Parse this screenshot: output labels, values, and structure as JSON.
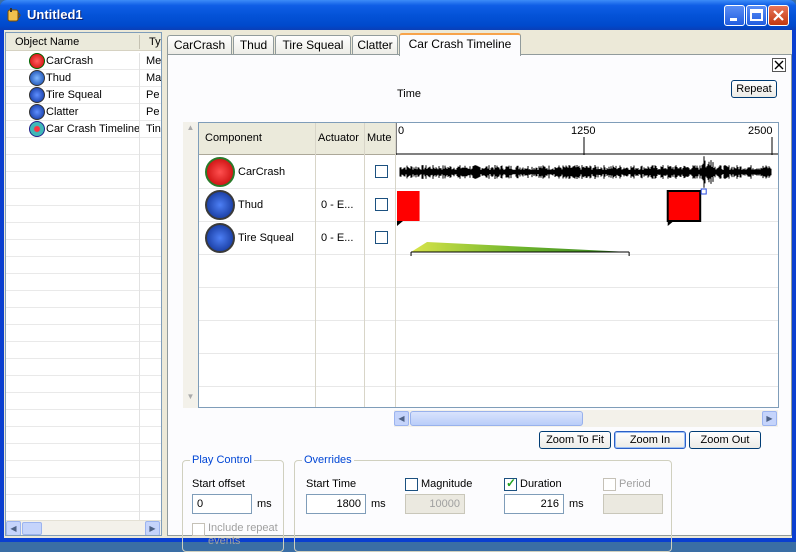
{
  "window": {
    "title": "Untitled1",
    "app_icon": "cup-icon"
  },
  "left_panel": {
    "columns": [
      "Object Name",
      "Ty"
    ],
    "rows": [
      {
        "name": "CarCrash",
        "type": "Me",
        "icon": "compound-effect-icon"
      },
      {
        "name": "Thud",
        "type": "Ma",
        "icon": "magnitude-effect-icon"
      },
      {
        "name": "Tire Squeal",
        "type": "Pe",
        "icon": "periodic-effect-icon"
      },
      {
        "name": "Clatter",
        "type": "Pe",
        "icon": "periodic-effect-icon"
      },
      {
        "name": "Car Crash Timeline",
        "type": "Tin",
        "icon": "timeline-icon"
      }
    ]
  },
  "tabs": [
    {
      "label": "CarCrash"
    },
    {
      "label": "Thud"
    },
    {
      "label": "Tire Squeal"
    },
    {
      "label": "Clatter"
    },
    {
      "label": "Car Crash Timeline",
      "active": true
    }
  ],
  "timeline": {
    "time_label": "Time",
    "repeat_label": "Repeat",
    "header": {
      "component": "Component",
      "actuator": "Actuator",
      "mute": "Mute"
    },
    "ruler_ticks": [
      "0",
      "1250",
      "2500"
    ],
    "ruler_range_ms": [
      0,
      2500
    ],
    "components": [
      {
        "name": "CarCrash",
        "actuator": "",
        "muted": false,
        "icon": "compound-effect-icon"
      },
      {
        "name": "Thud",
        "actuator": "0 - E...",
        "muted": false,
        "icon": "magnitude-effect-icon"
      },
      {
        "name": "Tire Squeal",
        "actuator": "0 - E...",
        "muted": false,
        "icon": "periodic-effect-icon"
      }
    ],
    "thud_events_ms": [
      {
        "start": 0,
        "duration": 150
      },
      {
        "start": 1800,
        "duration": 216
      }
    ],
    "tire_squeal_span_ms": [
      100,
      1550
    ],
    "zoom_buttons": [
      "Zoom To Fit",
      "Zoom In",
      "Zoom Out"
    ]
  },
  "play_control": {
    "title": "Play Control",
    "start_offset_label": "Start offset",
    "start_offset_value": "0",
    "unit": "ms",
    "include_repeat_label": "Include repeat events"
  },
  "overrides": {
    "title": "Overrides",
    "start_time_label": "Start Time",
    "start_time_value": "1800",
    "start_time_unit": "ms",
    "magnitude_label": "Magnitude",
    "magnitude_checked": false,
    "magnitude_value": "10000",
    "duration_label": "Duration",
    "duration_checked": true,
    "duration_value": "216",
    "duration_unit": "ms",
    "period_label": "Period",
    "period_checked": false,
    "period_value": ""
  },
  "colors": {
    "accent": "#0046d5",
    "event_red": "#ff0000",
    "ramp_green": "#9acd32",
    "tab_highlight": "#f7a34b"
  }
}
